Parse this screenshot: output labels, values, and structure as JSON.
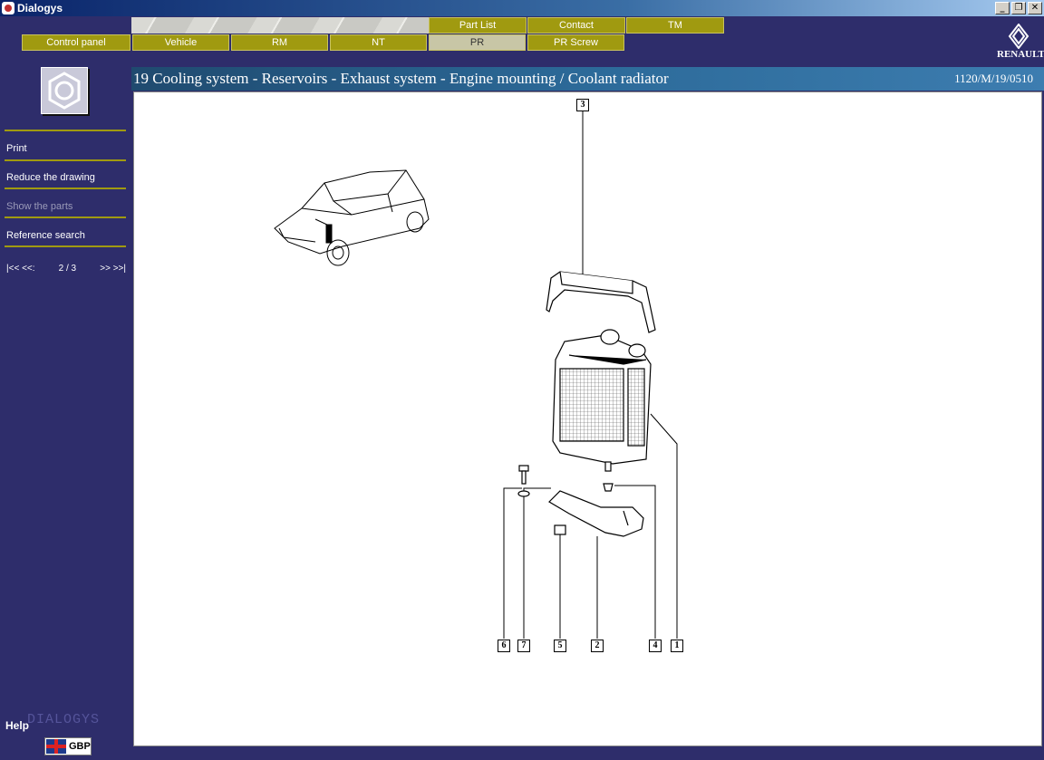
{
  "window": {
    "title": "Dialogys",
    "minimize": "_",
    "maximize": "❐",
    "close": "✕"
  },
  "tabs_top": [
    {
      "label": "Part List"
    },
    {
      "label": "Contact"
    },
    {
      "label": "TM"
    }
  ],
  "tabs_bottom": [
    {
      "label": "Control panel"
    },
    {
      "label": "Vehicle"
    },
    {
      "label": "RM"
    },
    {
      "label": "NT"
    },
    {
      "label": "PR",
      "active": true
    },
    {
      "label": "PR Screw"
    }
  ],
  "brand": {
    "logo_text": "RENAULT",
    "watermark": "DIALOGYS"
  },
  "sidebar": {
    "icon": "bolt-head-icon",
    "menu": [
      {
        "label": "Print",
        "enabled": true
      },
      {
        "label": "Reduce the drawing",
        "enabled": true
      },
      {
        "label": "Show the parts",
        "enabled": false
      },
      {
        "label": "Reference search",
        "enabled": true
      }
    ],
    "pager": {
      "first": "|<<",
      "prev": "<<:",
      "page": "2 / 3",
      "next": ">>",
      "last": ">>|"
    },
    "help": "Help",
    "currency": "GBP"
  },
  "header": {
    "title": "19 Cooling system - Reservoirs - Exhaust system - Engine mounting / Coolant radiator",
    "reference": "1120/M/19/0510"
  },
  "drawing": {
    "callouts": [
      "3",
      "6",
      "7",
      "5",
      "2",
      "4",
      "1"
    ]
  },
  "colors": {
    "navy": "#2e2d6b",
    "olive": "#a09a10",
    "header_blue": "#2c6a99"
  }
}
